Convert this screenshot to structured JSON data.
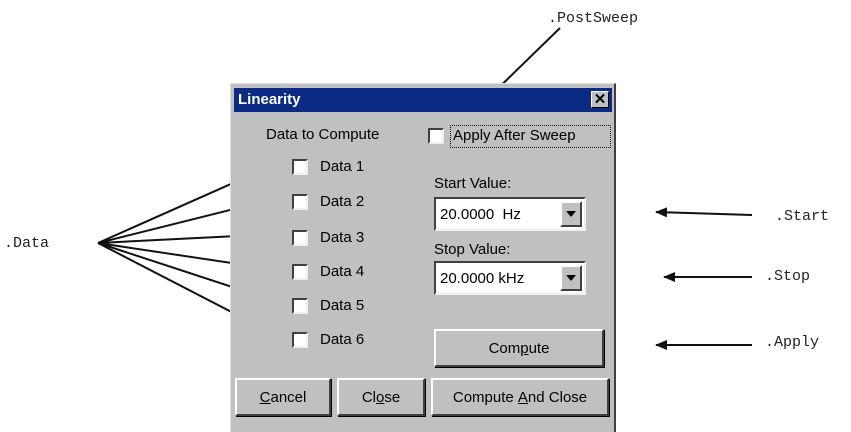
{
  "annotations": {
    "post_sweep": ".PostSweep",
    "data": ".Data",
    "start": ".Start",
    "stop": ".Stop",
    "apply": ".Apply"
  },
  "dialog": {
    "title": "Linearity",
    "close_glyph": "✕",
    "data_to_compute_label": "Data to Compute",
    "apply_after_sweep_label": "Apply After Sweep",
    "data_items": [
      {
        "label": "Data 1",
        "checked": false
      },
      {
        "label": "Data 2",
        "checked": false
      },
      {
        "label": "Data 3",
        "checked": false
      },
      {
        "label": "Data 4",
        "checked": false
      },
      {
        "label": "Data 5",
        "checked": false
      },
      {
        "label": "Data 6",
        "checked": false
      }
    ],
    "start_value_label": "Start Value:",
    "start_value": "20.0000  Hz",
    "stop_value_label": "Stop Value:",
    "stop_value": "20.0000 kHz",
    "compute_button": {
      "before": "Com",
      "mnemonic": "p",
      "after": "ute"
    },
    "cancel_button": {
      "before": "",
      "mnemonic": "C",
      "after": "ancel"
    },
    "close_button": {
      "before": "Cl",
      "mnemonic": "o",
      "after": "se"
    },
    "compute_and_close_button": {
      "before": "Compute ",
      "mnemonic": "A",
      "after": "nd Close"
    }
  },
  "colors": {
    "title_bar": "#0a2a84",
    "dialog_face": "#c0c0c0"
  }
}
